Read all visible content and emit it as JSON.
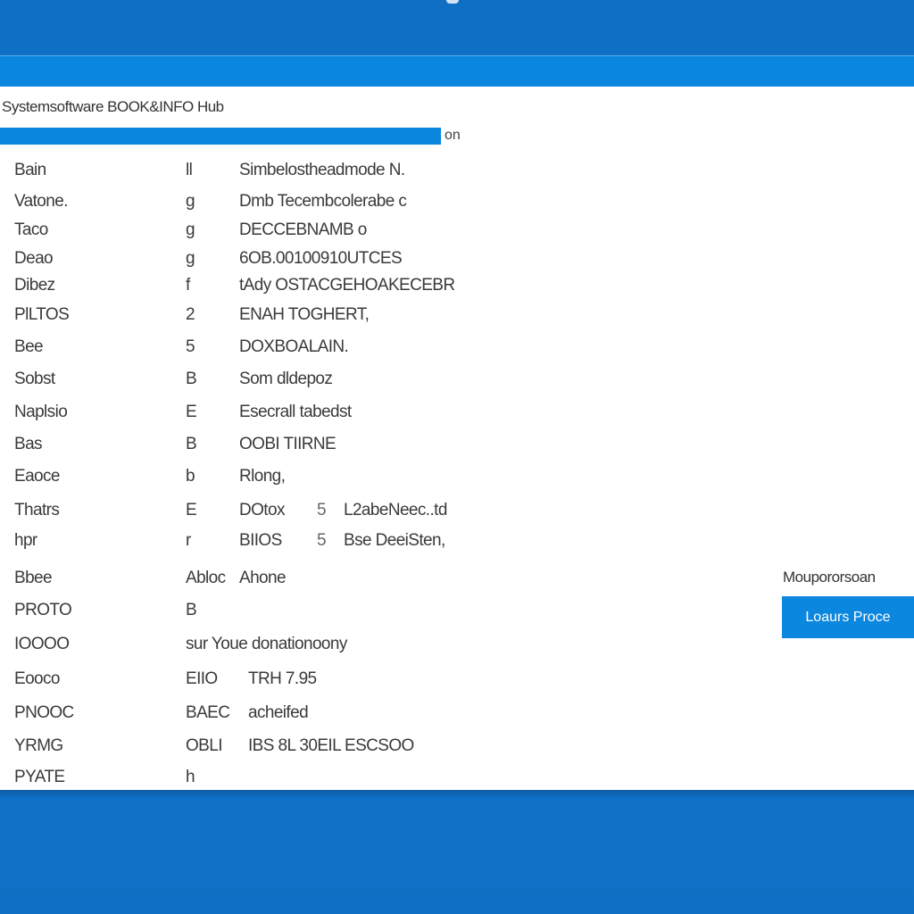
{
  "window": {
    "title": "Systemsoftware BOOK&INFO Hub"
  },
  "progress": {
    "percent": 100,
    "label": "on"
  },
  "rows": [
    {
      "label": "Bain",
      "mid": "ll",
      "value": "Simbelostheadmode N."
    },
    {
      "label": "Vatone.",
      "mid": "g",
      "value": "Dmb Tecembcolerabe c"
    },
    {
      "label": "Taco",
      "mid": "g",
      "value": "DECCEBNAMB o"
    },
    {
      "label": "Deao",
      "mid": "g",
      "value": "6OB.00100910UTCES"
    },
    {
      "label": "Dibez",
      "mid": "f",
      "value": "tAdy OSTACGEHOAKECEBR"
    },
    {
      "label": "PlLTOS",
      "mid": "2",
      "value": "ENAH TOGHERT,"
    },
    {
      "label": "Bee",
      "mid": "5",
      "value": "DOXBOALAIN."
    },
    {
      "label": "Sobst",
      "mid": "B",
      "value": "Som dldepoz"
    },
    {
      "label": "Naplsio",
      "mid": "E",
      "value": "Esecrall tabedst"
    },
    {
      "label": "Bas",
      "mid": "B",
      "value": "OOBI TIIRNE"
    },
    {
      "label": "Eaoce",
      "mid": "b",
      "value": "Rlong,"
    },
    {
      "label": "Thatrs",
      "mid": "E",
      "value": "DOtox",
      "extra1": "5",
      "extra2": "L2abeNeec..td"
    },
    {
      "label": "hpr",
      "mid": "r",
      "value": "BIIOS",
      "extra1": "5",
      "extra2": "Bse DeeiSten,"
    },
    {
      "label": "Bbee",
      "mid": "Abloc",
      "value": "Ahone"
    },
    {
      "label": "PROTO",
      "mid": "B",
      "value": ""
    },
    {
      "label": "IOOOO",
      "mid": "sur Youe donationoony",
      "value": ""
    },
    {
      "label": "Eooco",
      "mid": "EIIO",
      "value": "TRH 7.95"
    },
    {
      "label": "PNOOC",
      "mid": "BAEC",
      "value": "acheifed"
    },
    {
      "label": "YRMG",
      "mid": "OBLI",
      "value": "IBS 8L 30EIL ESCSOO"
    },
    {
      "label": "PYATE",
      "mid": "h",
      "value": ""
    }
  ],
  "side": {
    "label": "Moupororsoan",
    "button_label": "Loaurs Proce"
  },
  "colors": {
    "accent": "#0c87df",
    "background": "#1177cc",
    "panel": "#ffffff"
  }
}
